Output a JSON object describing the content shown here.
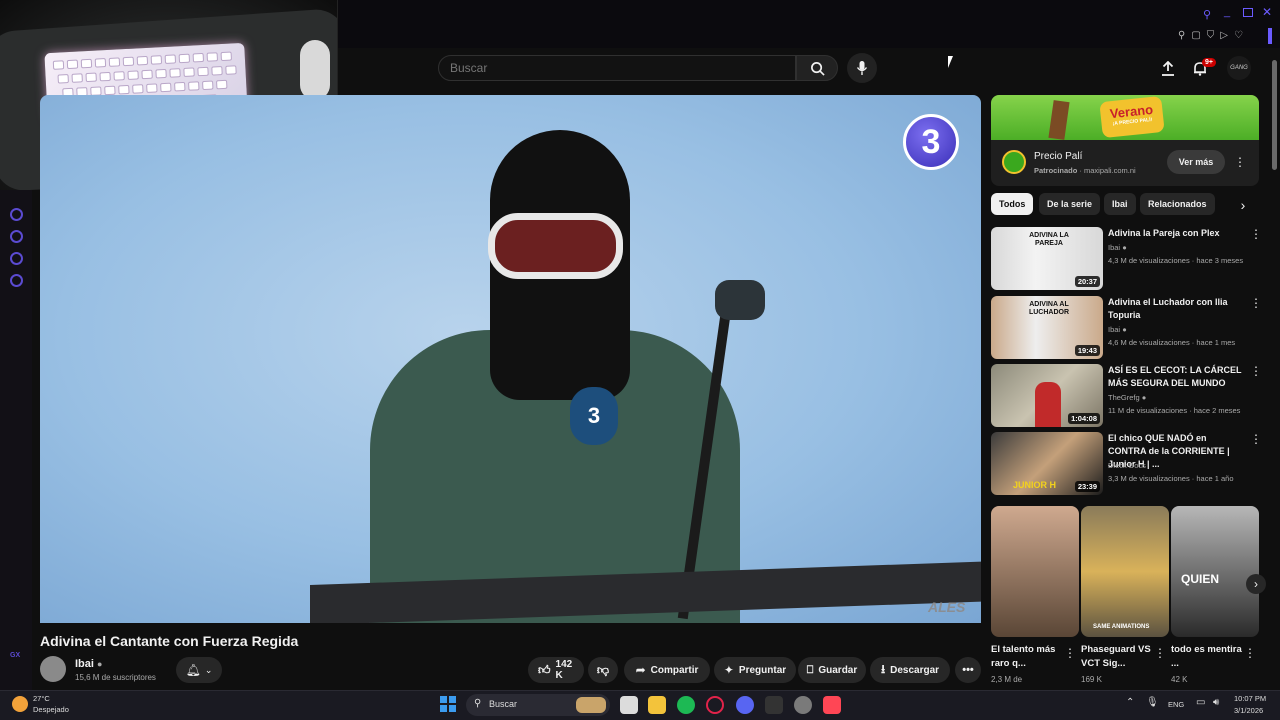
{
  "header": {
    "search_placeholder": "Buscar",
    "notification_badge": "9+",
    "profile_label": "GANG"
  },
  "video": {
    "title": "Adivina el Cantante con Fuerza Regida",
    "channel_overlay_badge": "3",
    "hoodie_badge": "3",
    "piano_brand": "ALES"
  },
  "channel": {
    "name": "Ibai",
    "subscribers": "15,6 M de suscriptores"
  },
  "actions": {
    "likes": "142 K",
    "share": "Compartir",
    "ask": "Preguntar",
    "save": "Guardar",
    "download": "Descargar"
  },
  "ad": {
    "banner_text": "Verano",
    "banner_subtext": "¡A PRECIO PALÍ!",
    "name": "Precio Palí",
    "sponsored": "Patrocinado",
    "domain": "maxipali.com.ni",
    "cta": "Ver más"
  },
  "chips": [
    "Todos",
    "De la serie",
    "Ibai",
    "Relacionados"
  ],
  "related": [
    {
      "title": "Adivina la Pareja con Plex",
      "channel": "Ibai",
      "meta": "4,3 M de visualizaciones · hace 3 meses",
      "duration": "20:37",
      "thumb_text": "ADIVINA LA PAREJA"
    },
    {
      "title": "Adivina el Luchador con Ilia Topuria",
      "channel": "Ibai",
      "meta": "4,6 M de visualizaciones · hace 1 mes",
      "duration": "19:43",
      "thumb_text": "ADIVINA AL LUCHADOR"
    },
    {
      "title": "ASÍ ES EL CECOT: LA CÁRCEL MÁS SEGURA DEL MUNDO",
      "channel": "TheGrefg",
      "meta": "11 M de visualizaciones · hace 2 meses",
      "duration": "1:04:08",
      "thumb_text": ""
    },
    {
      "title": "El chico QUE NADÓ en CONTRA de la CORRIENTE | Junior H | ...",
      "channel": "Dieck Docs",
      "meta": "3,3 M de visualizaciones · hace 1 año",
      "duration": "23:39",
      "thumb_text": "JUNIOR H"
    }
  ],
  "shorts": [
    {
      "title": "El talento más raro q...",
      "views": "2,3 M de",
      "thumb_text": ""
    },
    {
      "title": "Phaseguard VS VCT Sig...",
      "views": "169 K",
      "thumb_text": "SAME ANIMATIONS"
    },
    {
      "title": "todo es mentira ...",
      "views": "42 K",
      "thumb_text": "QUIEN"
    }
  ],
  "taskbar": {
    "weather_temp": "27°C",
    "weather_desc": "Despejado",
    "search": "Buscar",
    "lang": "ENG",
    "time": "10:07 PM",
    "date": "3/1/2026"
  },
  "left_rail_label": "GX",
  "colors": {
    "accent": "#5b4bd1",
    "like_red": "#ff0033",
    "ad_green": "#4cae26"
  }
}
